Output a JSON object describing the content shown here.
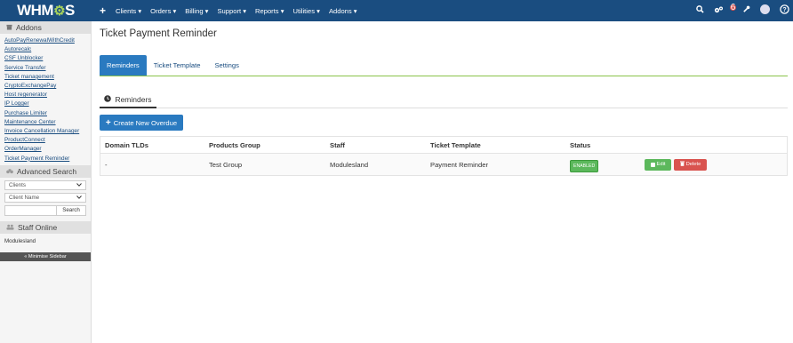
{
  "topbar": {
    "logo_text": "WHM",
    "logo_cog": "⚙",
    "logo_suffix": "S",
    "plus": "+",
    "menu": [
      "Clients ▾",
      "Orders ▾",
      "Billing ▾",
      "Support ▾",
      "Reports ▾",
      "Utilities ▾",
      "Addons ▾"
    ],
    "notification_count": "6"
  },
  "sidebar": {
    "addons_title": "Addons",
    "addons": [
      "AutoPayRenewalWithCredit",
      "Autorecalc",
      "CSF Unblocker",
      "Service Transfer",
      "Ticket management",
      "CryptoExchangePay",
      "Host regenerator",
      "IP Logger",
      "Purchase Limiter",
      "Maintenance Center",
      "Invoice Cancellation Manager",
      "ProductConnect",
      "OrderManager",
      "Ticket Payment Reminder"
    ],
    "advanced_search_title": "Advanced Search",
    "search_type": "Clients",
    "search_field": "Client Name",
    "search_button": "Search",
    "staff_online_title": "Staff Online",
    "staff_name": "Modulesland",
    "minimise": "« Minimise Sidebar"
  },
  "main": {
    "title": "Ticket Payment Reminder",
    "tabs": [
      "Reminders",
      "Ticket Template",
      "Settings"
    ],
    "subtab": "Reminders",
    "create_button": "Create New Overdue",
    "table": {
      "headers": [
        "Domain TLDs",
        "Products Group",
        "Staff",
        "Ticket Template",
        "Status"
      ],
      "rows": [
        {
          "domain_tlds": "-",
          "products_group": "Test Group",
          "staff": "Modulesland",
          "ticket_template": "Payment Reminder",
          "status": "ENABLED",
          "edit": "Edit",
          "delete": "Delete"
        }
      ]
    }
  },
  "colors": {
    "navbar": "#1a4d80",
    "primary": "#2a7ac0",
    "success": "#5cb85c",
    "danger": "#d9534f",
    "accent_line": "#8bc34a"
  }
}
